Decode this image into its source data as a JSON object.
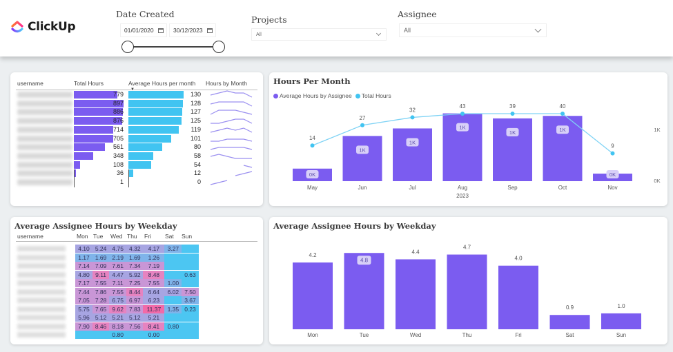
{
  "brand": {
    "name": "ClickUp",
    "logo_icon": "clickup-logo-icon"
  },
  "filters": {
    "date_created": {
      "label": "Date Created",
      "start": "01/01/2020",
      "end": "30/12/2023",
      "range": [
        0.0,
        1.0
      ]
    },
    "projects": {
      "label": "Projects",
      "value": "All"
    },
    "assignee": {
      "label": "Assignee",
      "value": "All"
    }
  },
  "colors": {
    "purple": "#7b5cf0",
    "cyan": "#41c4f1",
    "pink": "#f06aa6"
  },
  "hours_table": {
    "columns": [
      "username",
      "Total Hours",
      "Average Hours per month",
      "Hours by Month"
    ],
    "sort_indicator": "sort-descending-icon",
    "rows": [
      {
        "total": 779,
        "avg": 130,
        "spark": [
          2,
          3,
          4,
          3,
          3,
          1
        ]
      },
      {
        "total": 897,
        "avg": 128,
        "spark": [
          2,
          3,
          3,
          3,
          3,
          1
        ]
      },
      {
        "total": 886,
        "avg": 127,
        "spark": [
          1,
          3,
          3,
          3,
          2,
          1
        ]
      },
      {
        "total": 876,
        "avg": 125,
        "spark": [
          1,
          1,
          2,
          3,
          3,
          1
        ]
      },
      {
        "total": 714,
        "avg": 119,
        "spark": [
          1,
          2,
          3,
          2,
          3,
          1
        ]
      },
      {
        "total": 705,
        "avg": 101,
        "spark": [
          1,
          1,
          2,
          2,
          2,
          1
        ]
      },
      {
        "total": 561,
        "avg": 80,
        "spark": [
          1,
          2,
          2,
          2,
          2,
          1
        ]
      },
      {
        "total": 348,
        "avg": 58,
        "spark": [
          2,
          3,
          2,
          1,
          1,
          1
        ]
      },
      {
        "total": 108,
        "avg": 54,
        "spark": [
          null,
          null,
          null,
          null,
          2,
          1
        ]
      },
      {
        "total": 36,
        "avg": 12,
        "spark": [
          null,
          null,
          null,
          1,
          2,
          3
        ]
      },
      {
        "total": 1,
        "avg": 0,
        "spark": [
          1,
          2,
          3,
          null,
          null,
          null
        ]
      }
    ]
  },
  "weekday_table": {
    "title": "Average Assignee Hours by Weekday",
    "columns": [
      "username",
      "Mon",
      "Tue",
      "Wed",
      "Thu",
      "Fri",
      "Sat",
      "Sun"
    ],
    "rows": [
      [
        "4.10",
        "5.24",
        "4.75",
        "4.32",
        "4.17",
        "3.27",
        ""
      ],
      [
        "1.17",
        "1.69",
        "2.19",
        "1.69",
        "1.26",
        "",
        ""
      ],
      [
        "7.14",
        "7.09",
        "7.61",
        "7.34",
        "7.19",
        "",
        ""
      ],
      [
        "4.80",
        "9.11",
        "4.47",
        "5.92",
        "8.48",
        "",
        "0.63"
      ],
      [
        "7.17",
        "7.55",
        "7.11",
        "7.25",
        "7.55",
        "1.00",
        ""
      ],
      [
        "7.44",
        "7.86",
        "7.55",
        "8.44",
        "6.64",
        "6.02",
        "7.50"
      ],
      [
        "7.05",
        "7.28",
        "6.75",
        "6.97",
        "6.23",
        "",
        "3.67"
      ],
      [
        "5.75",
        "7.65",
        "9.62",
        "7.83",
        "11.37",
        "1.35",
        "0.23"
      ],
      [
        "5.96",
        "5.12",
        "5.21",
        "5.12",
        "5.21",
        "",
        ""
      ],
      [
        "7.90",
        "8.46",
        "8.18",
        "7.56",
        "8.41",
        "0.80",
        ""
      ],
      [
        "",
        "",
        "0.80",
        "",
        "0.00",
        "",
        ""
      ]
    ]
  },
  "chart_data": [
    {
      "type": "bar",
      "title": "Hours Per Month",
      "legend": [
        "Average Hours by Assignee",
        "Total Hours"
      ],
      "legend_position": "top-left",
      "categories": [
        "May",
        "Jun",
        "Jul",
        "Aug",
        "Sep",
        "Oct",
        "Nov"
      ],
      "x_group_label": "2023",
      "series": [
        {
          "name": "Average Hours by Assignee",
          "kind": "line",
          "values": [
            14,
            27,
            32,
            43,
            39,
            40,
            9
          ],
          "labels": [
            "14",
            "27",
            "32",
            "43",
            "39",
            "40",
            "9"
          ]
        },
        {
          "name": "Total Hours",
          "kind": "bar",
          "values": [
            250,
            900,
            1050,
            1350,
            1250,
            1300,
            150
          ],
          "labels": [
            "0K",
            "1K",
            "1K",
            "1K",
            "1K",
            "1K",
            "0K"
          ]
        }
      ],
      "y2_ticks": [
        "0K",
        "1K"
      ],
      "y2lim": [
        0,
        1600
      ],
      "ylim": [
        0,
        50
      ]
    },
    {
      "type": "bar",
      "title": "Average Assignee Hours by Weekday",
      "categories": [
        "Mon",
        "Tue",
        "Wed",
        "Thu",
        "Fri",
        "Sat",
        "Sun"
      ],
      "values": [
        4.2,
        4.8,
        4.4,
        4.7,
        4.0,
        0.9,
        1.0
      ],
      "labels": [
        "4.2",
        "4.8",
        "4.4",
        "4.7",
        "4.0",
        "0.9",
        "1.0"
      ],
      "highlighted_label_index": 1,
      "ylim": [
        0,
        5.2
      ]
    }
  ]
}
